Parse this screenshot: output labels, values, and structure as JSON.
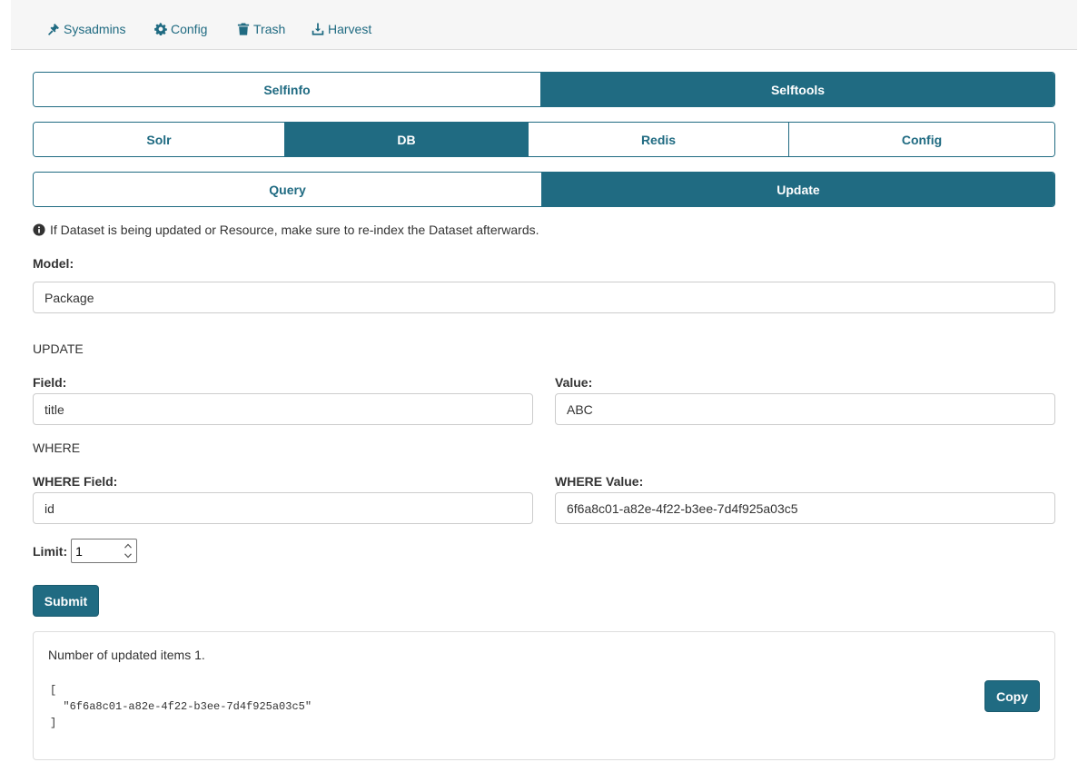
{
  "topnav": {
    "items": [
      {
        "label": "Sysadmins",
        "icon": "gavel-icon"
      },
      {
        "label": "Config",
        "icon": "gear-icon"
      },
      {
        "label": "Trash",
        "icon": "trash-icon"
      },
      {
        "label": "Harvest",
        "icon": "download-icon"
      }
    ]
  },
  "main_tabs": [
    {
      "label": "Selfinfo",
      "active": false
    },
    {
      "label": "Selftools",
      "active": true
    }
  ],
  "tool_tabs": [
    {
      "label": "Solr",
      "active": false
    },
    {
      "label": "DB",
      "active": true
    },
    {
      "label": "Redis",
      "active": false
    },
    {
      "label": "Config",
      "active": false
    }
  ],
  "db_tabs": [
    {
      "label": "Query",
      "active": false
    },
    {
      "label": "Update",
      "active": true
    }
  ],
  "info": {
    "text": "If Dataset is being updated or Resource, make sure to re-index the Dataset afterwards.",
    "icon": "info-circle-icon"
  },
  "form": {
    "model_label": "Model:",
    "model_value": "Package",
    "update_heading": "UPDATE",
    "field_label": "Field:",
    "field_value": "title",
    "value_label": "Value:",
    "value_value": "ABC",
    "where_heading": "WHERE",
    "where_field_label": "WHERE Field:",
    "where_field_value": "id",
    "where_value_label": "WHERE Value:",
    "where_value_value": "6f6a8c01-a82e-4f22-b3ee-7d4f925a03c5",
    "limit_label": "Limit:",
    "limit_value": "1",
    "submit_label": "Submit"
  },
  "result": {
    "message": "Number of updated items 1.",
    "json_text": "[\n  \"6f6a8c01-a82e-4f22-b3ee-7d4f925a03c5\"\n]",
    "copy_label": "Copy"
  },
  "colors": {
    "accent": "#206b82",
    "topbar_bg": "#f6f6f6"
  }
}
